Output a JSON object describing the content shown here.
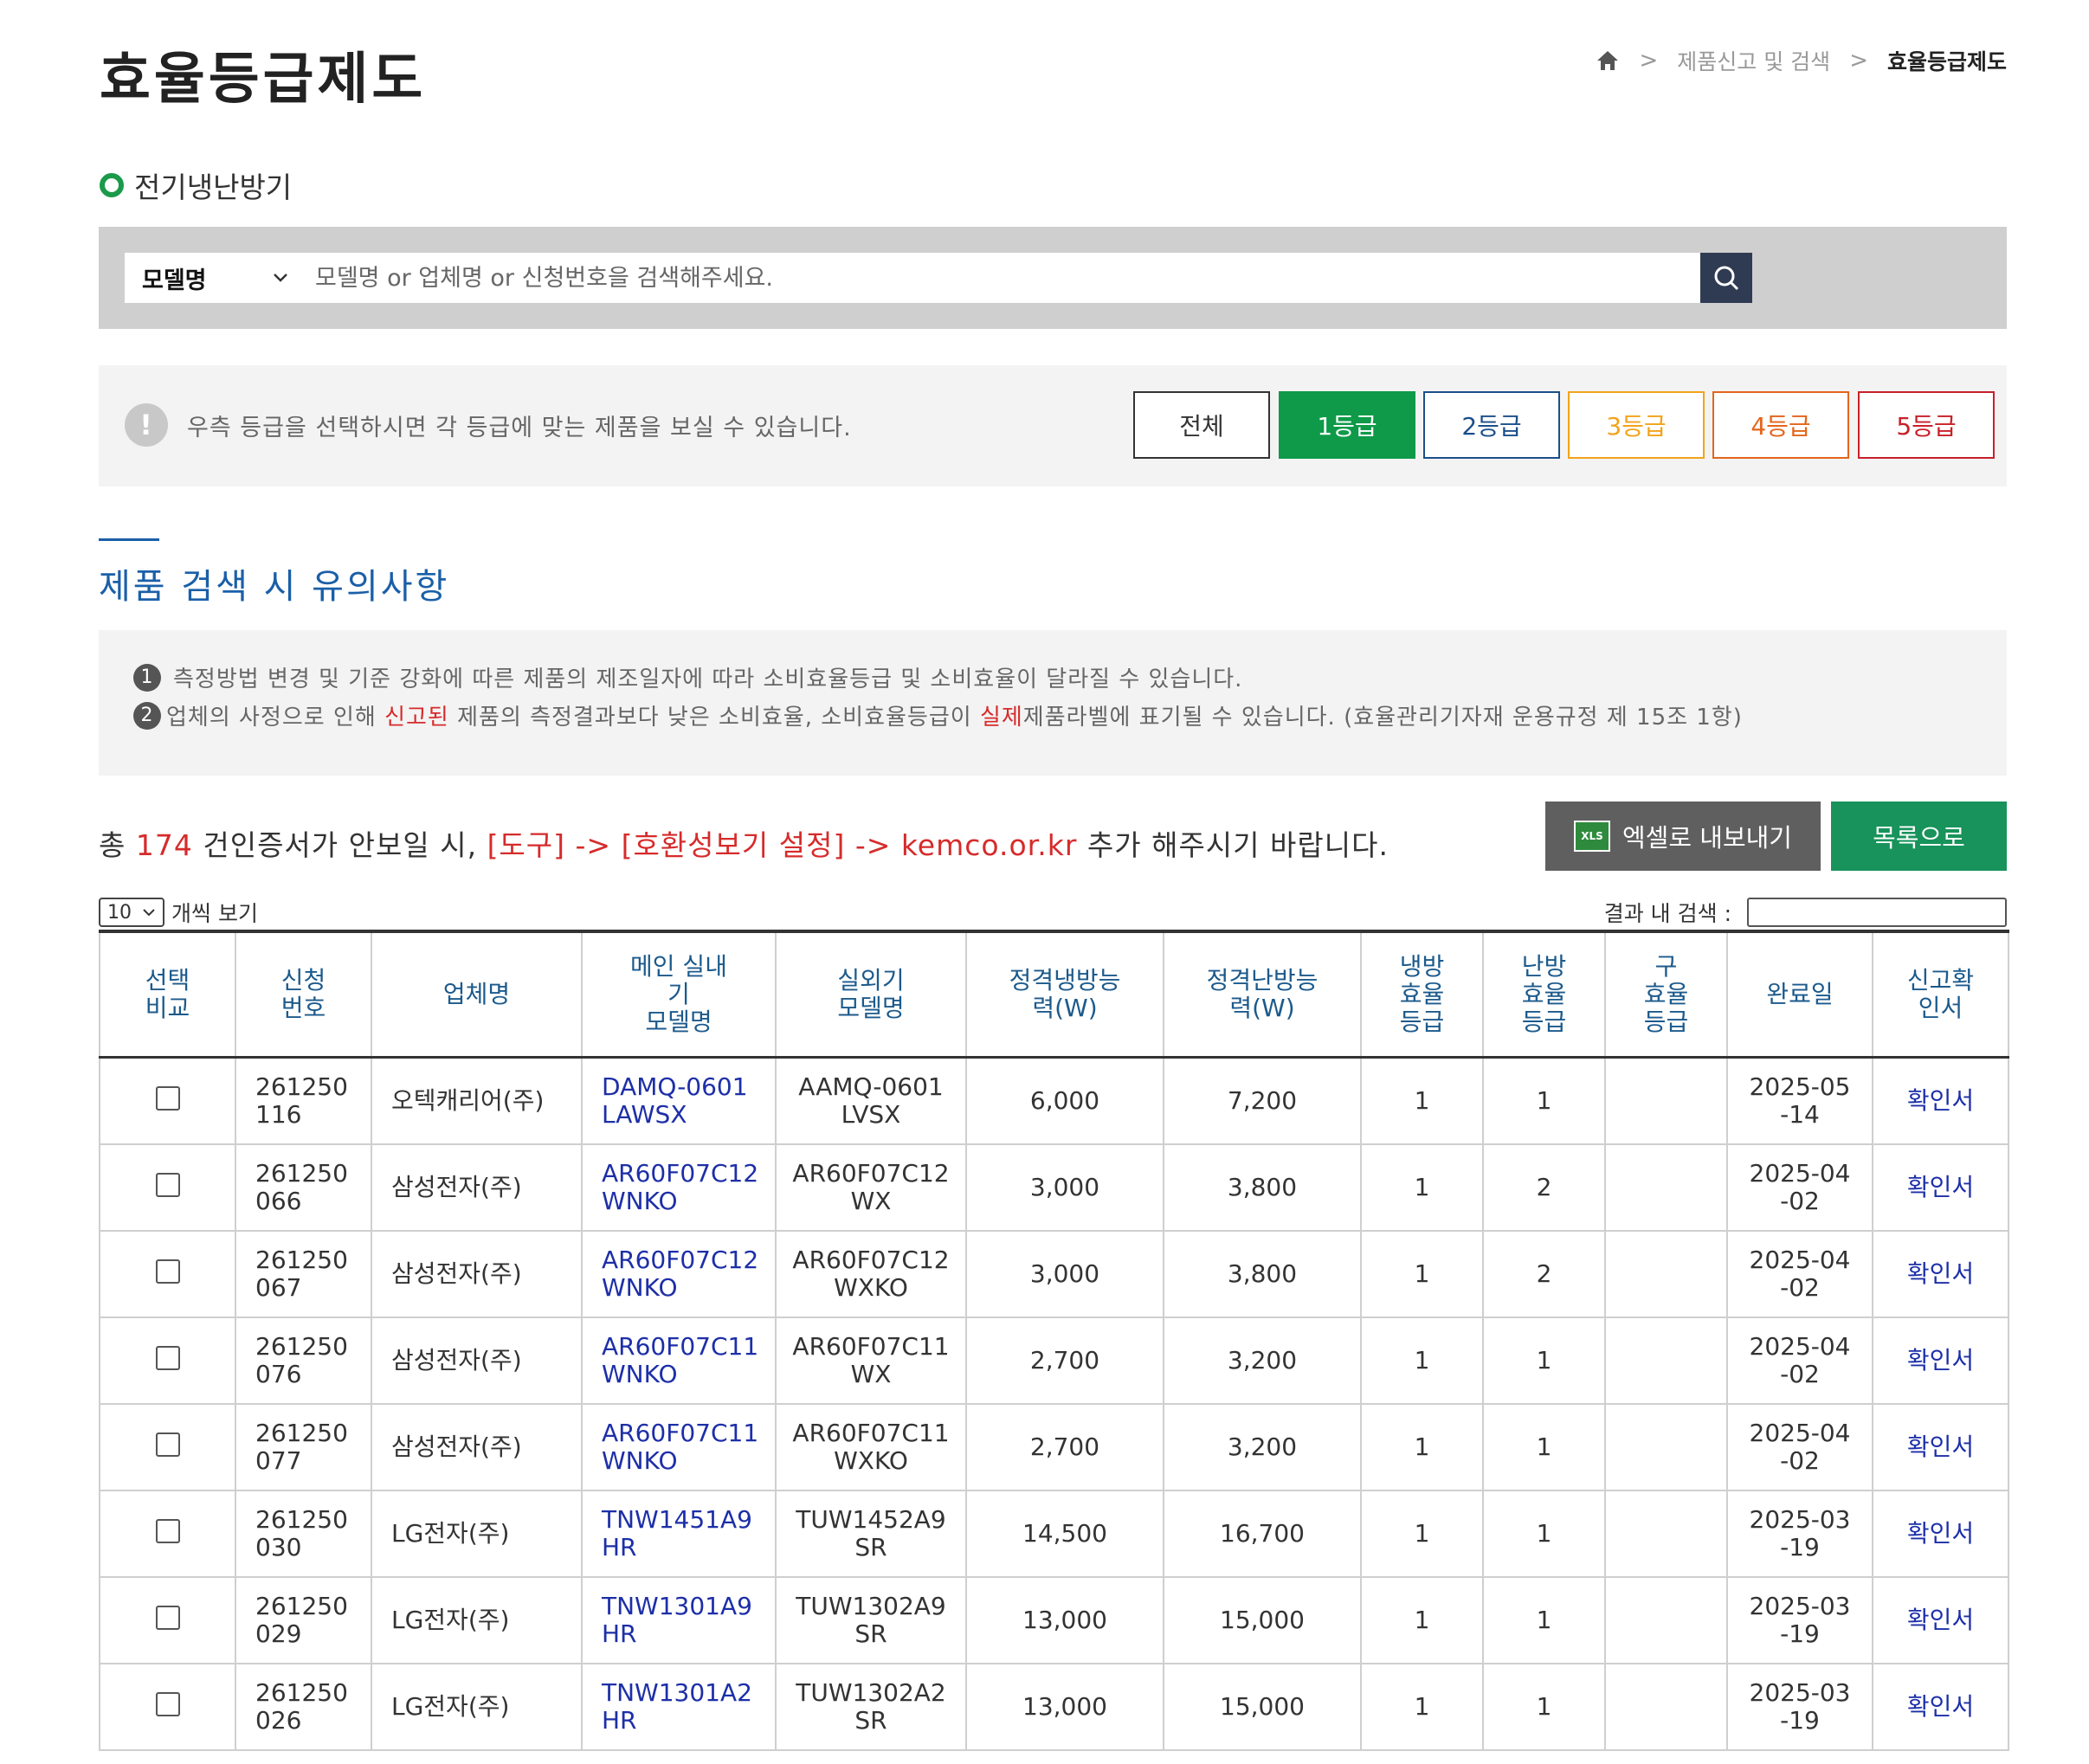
{
  "page": {
    "title": "효율등급제도",
    "breadcrumb": [
      "제품신고 및 검색",
      "효율등급제도"
    ],
    "category": "전기냉난방기"
  },
  "search": {
    "select_value": "모델명",
    "placeholder": "모델명 or 업체명 or 신청번호을 검색해주세요."
  },
  "grade_filter": {
    "info": "우측 등급을 선택하시면 각 등급에 맞는 제품을 보실 수 있습니다.",
    "buttons": [
      {
        "label": "전체",
        "color": "#333333"
      },
      {
        "label": "1등급",
        "color": "#0e9a48"
      },
      {
        "label": "2등급",
        "color": "#1b4f8a"
      },
      {
        "label": "3등급",
        "color": "#f2a31b"
      },
      {
        "label": "4등급",
        "color": "#e4651b"
      },
      {
        "label": "5등급",
        "color": "#c8202a"
      }
    ]
  },
  "notice": {
    "title": "제품 검색 시 유의사항",
    "items": [
      {
        "num": "1",
        "text": "측정방법 변경 및 기준 강화에 따른 제품의 제조일자에 따라 소비효율등급 및 소비효율이 달라질 수 있습니다."
      },
      {
        "num": "2",
        "pre": "업체의 사정으로 인해 ",
        "hl1": "신고된",
        "mid": " 제품의 측정결과보다 낮은 소비효율, 소비효율등급이 ",
        "hl2": "실제",
        "post": "제품라벨에 표기될 수 있습니다. (효율관리기자재 운용규정 제 15조 1항)"
      }
    ]
  },
  "results": {
    "prefix": "총 ",
    "count": "174",
    "suffix": " 건인증서가 안보일 시, ",
    "tip": "[도구] -> [호환성보기 설정] -> kemco.or.kr",
    "tail": " 추가 해주시기 바랍니다."
  },
  "buttons": {
    "excel": "엑셀로 내보내기",
    "excel_icon_text": "XLS",
    "list": "목록으로"
  },
  "table_controls": {
    "per_page_value": "10",
    "per_page_label": "개씩 보기",
    "inner_search_label": "결과 내 검색 :"
  },
  "table": {
    "headers": [
      "선택\n비교",
      "신청\n번호",
      "업체명",
      "메인 실내\n기\n모델명",
      "실외기\n모델명",
      "정격냉방능\n력(W)",
      "정격난방능\n력(W)",
      "냉방\n효율\n등급",
      "난방\n효율\n등급",
      "구\n효율\n등급",
      "완료일",
      "신고확\n인서"
    ],
    "rows": [
      {
        "no": "261250\n116",
        "company": "오텍캐리어(주)",
        "indoor": "DAMQ-0601\nLAWSX",
        "outdoor": "AAMQ-0601\nLVSX",
        "cool": "6,000",
        "heat": "7,200",
        "cg": "1",
        "hg": "1",
        "old": "",
        "date": "2025-05\n-14",
        "cert": "확인서"
      },
      {
        "no": "261250\n066",
        "company": "삼성전자(주)",
        "indoor": "AR60F07C12\nWNKO",
        "outdoor": "AR60F07C12\nWX",
        "cool": "3,000",
        "heat": "3,800",
        "cg": "1",
        "hg": "2",
        "old": "",
        "date": "2025-04\n-02",
        "cert": "확인서"
      },
      {
        "no": "261250\n067",
        "company": "삼성전자(주)",
        "indoor": "AR60F07C12\nWNKO",
        "outdoor": "AR60F07C12\nWXKO",
        "cool": "3,000",
        "heat": "3,800",
        "cg": "1",
        "hg": "2",
        "old": "",
        "date": "2025-04\n-02",
        "cert": "확인서"
      },
      {
        "no": "261250\n076",
        "company": "삼성전자(주)",
        "indoor": "AR60F07C11\nWNKO",
        "outdoor": "AR60F07C11\nWX",
        "cool": "2,700",
        "heat": "3,200",
        "cg": "1",
        "hg": "1",
        "old": "",
        "date": "2025-04\n-02",
        "cert": "확인서"
      },
      {
        "no": "261250\n077",
        "company": "삼성전자(주)",
        "indoor": "AR60F07C11\nWNKO",
        "outdoor": "AR60F07C11\nWXKO",
        "cool": "2,700",
        "heat": "3,200",
        "cg": "1",
        "hg": "1",
        "old": "",
        "date": "2025-04\n-02",
        "cert": "확인서"
      },
      {
        "no": "261250\n030",
        "company": "LG전자(주)",
        "indoor": "TNW1451A9\nHR",
        "outdoor": "TUW1452A9\nSR",
        "cool": "14,500",
        "heat": "16,700",
        "cg": "1",
        "hg": "1",
        "old": "",
        "date": "2025-03\n-19",
        "cert": "확인서"
      },
      {
        "no": "261250\n029",
        "company": "LG전자(주)",
        "indoor": "TNW1301A9\nHR",
        "outdoor": "TUW1302A9\nSR",
        "cool": "13,000",
        "heat": "15,000",
        "cg": "1",
        "hg": "1",
        "old": "",
        "date": "2025-03\n-19",
        "cert": "확인서"
      },
      {
        "no": "261250\n026",
        "company": "LG전자(주)",
        "indoor": "TNW1301A2\nHR",
        "outdoor": "TUW1302A2\nSR",
        "cool": "13,000",
        "heat": "15,000",
        "cg": "1",
        "hg": "1",
        "old": "",
        "date": "2025-03\n-19",
        "cert": "확인서"
      }
    ]
  }
}
